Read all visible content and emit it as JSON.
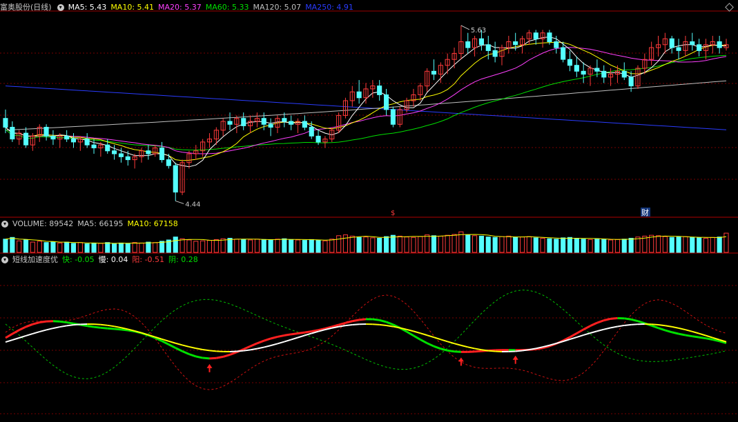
{
  "colors": {
    "bg": "#000000",
    "up": "#ff3b3b",
    "down": "#54ffff",
    "grid": "#7a0000",
    "ma5": "#ffffff",
    "ma10": "#ffff00",
    "ma20": "#ff40ff",
    "ma60": "#00e000",
    "ma120": "#c0c0c0",
    "ma250": "#2a3cff"
  },
  "main": {
    "stock_name": "富奥股份(日线)",
    "ma_legend": [
      {
        "text": "MA5: 5.43",
        "color": "#ffffff"
      },
      {
        "text": "MA10: 5.41",
        "color": "#ffff00"
      },
      {
        "text": "MA20: 5.37",
        "color": "#ff40ff"
      },
      {
        "text": "MA60: 5.33",
        "color": "#00e000"
      },
      {
        "text": "MA120: 5.07",
        "color": "#c0c0c0"
      },
      {
        "text": "MA250: 4.91",
        "color": "#2a3cff"
      }
    ],
    "high_label": "5.63",
    "low_label": "4.44",
    "event_s": "$",
    "event_cai": "财"
  },
  "volume": {
    "legend": [
      {
        "text": "VOLUME: 89542",
        "color": "#c8c8c8"
      },
      {
        "text": "MA5: 66195",
        "color": "#c8c8c8"
      },
      {
        "text": "MA10: 67158",
        "color": "#ffff00"
      }
    ]
  },
  "indicator": {
    "name": "短线加速度优",
    "legend": [
      {
        "text": "快: -0.05",
        "color": "#00e000"
      },
      {
        "text": "慢: 0.04",
        "color": "#ffffff"
      },
      {
        "text": "阳: -0.51",
        "color": "#ff3b3b"
      },
      {
        "text": "阴: 0.28",
        "color": "#00e000"
      }
    ]
  },
  "chart_data": {
    "type": "candlestick",
    "ohlc": [
      [
        5.0,
        5.06,
        4.9,
        4.94
      ],
      [
        4.94,
        4.98,
        4.84,
        4.86
      ],
      [
        4.86,
        4.92,
        4.82,
        4.9
      ],
      [
        4.9,
        4.94,
        4.8,
        4.82
      ],
      [
        4.82,
        4.9,
        4.78,
        4.88
      ],
      [
        4.88,
        4.96,
        4.84,
        4.94
      ],
      [
        4.94,
        4.96,
        4.85,
        4.88
      ],
      [
        4.88,
        4.92,
        4.82,
        4.86
      ],
      [
        4.86,
        4.9,
        4.8,
        4.88
      ],
      [
        4.88,
        4.92,
        4.84,
        4.86
      ],
      [
        4.86,
        4.9,
        4.8,
        4.84
      ],
      [
        4.84,
        4.88,
        4.78,
        4.86
      ],
      [
        4.86,
        4.9,
        4.8,
        4.82
      ],
      [
        4.82,
        4.86,
        4.76,
        4.8
      ],
      [
        4.8,
        4.84,
        4.74,
        4.82
      ],
      [
        4.82,
        4.86,
        4.76,
        4.78
      ],
      [
        4.78,
        4.82,
        4.72,
        4.76
      ],
      [
        4.76,
        4.8,
        4.7,
        4.74
      ],
      [
        4.74,
        4.78,
        4.68,
        4.72
      ],
      [
        4.72,
        4.76,
        4.66,
        4.74
      ],
      [
        4.74,
        4.8,
        4.7,
        4.78
      ],
      [
        4.78,
        4.82,
        4.72,
        4.76
      ],
      [
        4.76,
        4.82,
        4.74,
        4.8
      ],
      [
        4.8,
        4.84,
        4.7,
        4.72
      ],
      [
        4.72,
        4.76,
        4.66,
        4.68
      ],
      [
        4.68,
        4.7,
        4.44,
        4.5
      ],
      [
        4.5,
        4.72,
        4.48,
        4.7
      ],
      [
        4.7,
        4.78,
        4.66,
        4.76
      ],
      [
        4.76,
        4.82,
        4.72,
        4.78
      ],
      [
        4.78,
        4.86,
        4.74,
        4.84
      ],
      [
        4.84,
        4.9,
        4.8,
        4.86
      ],
      [
        4.86,
        4.94,
        4.82,
        4.92
      ],
      [
        4.92,
        5.0,
        4.88,
        4.98
      ],
      [
        4.98,
        5.04,
        4.92,
        4.96
      ],
      [
        4.96,
        5.02,
        4.9,
        5.0
      ],
      [
        5.0,
        5.04,
        4.92,
        4.95
      ],
      [
        4.95,
        5.02,
        4.9,
        4.98
      ],
      [
        4.98,
        5.04,
        4.94,
        5.0
      ],
      [
        5.0,
        5.04,
        4.92,
        4.96
      ],
      [
        4.96,
        5.0,
        4.88,
        4.94
      ],
      [
        4.94,
        5.02,
        4.9,
        5.0
      ],
      [
        5.0,
        5.04,
        4.94,
        4.98
      ],
      [
        4.98,
        5.02,
        4.92,
        4.96
      ],
      [
        4.96,
        5.0,
        4.9,
        4.98
      ],
      [
        4.98,
        5.02,
        4.92,
        4.94
      ],
      [
        4.94,
        4.98,
        4.86,
        4.88
      ],
      [
        4.88,
        4.92,
        4.82,
        4.84
      ],
      [
        4.84,
        4.88,
        4.8,
        4.86
      ],
      [
        4.86,
        4.94,
        4.84,
        4.92
      ],
      [
        4.92,
        5.04,
        4.9,
        5.02
      ],
      [
        5.02,
        5.14,
        5.0,
        5.12
      ],
      [
        5.12,
        5.22,
        5.08,
        5.18
      ],
      [
        5.18,
        5.26,
        5.1,
        5.14
      ],
      [
        5.14,
        5.24,
        5.1,
        5.2
      ],
      [
        5.2,
        5.26,
        5.14,
        5.22
      ],
      [
        5.22,
        5.26,
        5.12,
        5.16
      ],
      [
        5.16,
        5.2,
        5.02,
        5.06
      ],
      [
        5.06,
        5.08,
        4.94,
        4.96
      ],
      [
        4.96,
        5.08,
        4.94,
        5.06
      ],
      [
        5.06,
        5.14,
        5.04,
        5.12
      ],
      [
        5.12,
        5.2,
        5.08,
        5.16
      ],
      [
        5.16,
        5.24,
        5.12,
        5.22
      ],
      [
        5.22,
        5.34,
        5.18,
        5.32
      ],
      [
        5.32,
        5.4,
        5.26,
        5.3
      ],
      [
        5.3,
        5.38,
        5.24,
        5.36
      ],
      [
        5.36,
        5.44,
        5.3,
        5.4
      ],
      [
        5.4,
        5.48,
        5.34,
        5.44
      ],
      [
        5.44,
        5.63,
        5.4,
        5.52
      ],
      [
        5.52,
        5.58,
        5.44,
        5.48
      ],
      [
        5.48,
        5.56,
        5.42,
        5.54
      ],
      [
        5.54,
        5.6,
        5.46,
        5.5
      ],
      [
        5.5,
        5.56,
        5.4,
        5.46
      ],
      [
        5.46,
        5.52,
        5.38,
        5.42
      ],
      [
        5.42,
        5.5,
        5.36,
        5.48
      ],
      [
        5.48,
        5.56,
        5.44,
        5.52
      ],
      [
        5.52,
        5.58,
        5.46,
        5.5
      ],
      [
        5.5,
        5.56,
        5.44,
        5.54
      ],
      [
        5.54,
        5.6,
        5.5,
        5.58
      ],
      [
        5.58,
        5.6,
        5.5,
        5.54
      ],
      [
        5.54,
        5.6,
        5.48,
        5.58
      ],
      [
        5.58,
        5.6,
        5.5,
        5.52
      ],
      [
        5.52,
        5.56,
        5.44,
        5.48
      ],
      [
        5.48,
        5.52,
        5.38,
        5.4
      ],
      [
        5.4,
        5.46,
        5.32,
        5.36
      ],
      [
        5.36,
        5.42,
        5.28,
        5.32
      ],
      [
        5.32,
        5.38,
        5.24,
        5.3
      ],
      [
        5.3,
        5.36,
        5.22,
        5.34
      ],
      [
        5.34,
        5.4,
        5.28,
        5.32
      ],
      [
        5.32,
        5.36,
        5.24,
        5.28
      ],
      [
        5.28,
        5.34,
        5.22,
        5.3
      ],
      [
        5.3,
        5.36,
        5.24,
        5.32
      ],
      [
        5.32,
        5.38,
        5.26,
        5.28
      ],
      [
        5.28,
        5.32,
        5.18,
        5.22
      ],
      [
        5.22,
        5.36,
        5.2,
        5.34
      ],
      [
        5.34,
        5.44,
        5.3,
        5.4
      ],
      [
        5.4,
        5.52,
        5.36,
        5.48
      ],
      [
        5.48,
        5.56,
        5.42,
        5.5
      ],
      [
        5.5,
        5.58,
        5.44,
        5.54
      ],
      [
        5.54,
        5.56,
        5.44,
        5.48
      ],
      [
        5.48,
        5.54,
        5.4,
        5.46
      ],
      [
        5.46,
        5.56,
        5.42,
        5.52
      ],
      [
        5.52,
        5.58,
        5.46,
        5.5
      ],
      [
        5.5,
        5.54,
        5.42,
        5.46
      ],
      [
        5.46,
        5.54,
        5.4,
        5.5
      ],
      [
        5.5,
        5.56,
        5.44,
        5.52
      ],
      [
        5.52,
        5.56,
        5.44,
        5.48
      ],
      [
        5.48,
        5.54,
        5.46,
        5.5
      ]
    ],
    "volume": [
      62,
      70,
      54,
      58,
      48,
      52,
      46,
      50,
      44,
      48,
      42,
      46,
      40,
      44,
      42,
      46,
      40,
      44,
      42,
      46,
      44,
      48,
      46,
      52,
      58,
      72,
      64,
      58,
      52,
      54,
      56,
      60,
      64,
      66,
      62,
      60,
      58,
      62,
      60,
      58,
      62,
      64,
      60,
      58,
      56,
      60,
      58,
      54,
      62,
      78,
      82,
      76,
      70,
      72,
      68,
      66,
      74,
      80,
      76,
      72,
      70,
      74,
      82,
      78,
      76,
      80,
      84,
      96,
      82,
      78,
      76,
      72,
      70,
      74,
      76,
      70,
      72,
      74,
      68,
      66,
      64,
      62,
      68,
      70,
      66,
      62,
      60,
      64,
      62,
      58,
      60,
      62,
      66,
      72,
      76,
      80,
      78,
      74,
      70,
      72,
      74,
      70,
      68,
      66,
      70,
      72,
      90
    ],
    "labels": {
      "high": "5.63",
      "low": "4.44"
    }
  }
}
